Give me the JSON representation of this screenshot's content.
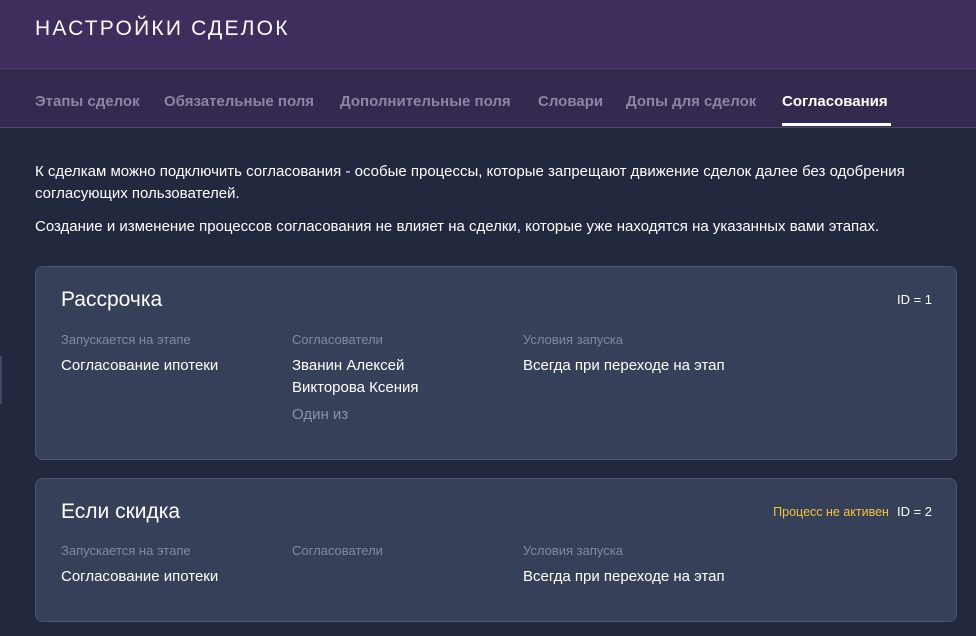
{
  "header": {
    "title": "НАСТРОЙКИ СДЕЛОК"
  },
  "tabs": [
    {
      "label": "Этапы сделок"
    },
    {
      "label": "Обязательные поля"
    },
    {
      "label": "Дополнительные поля"
    },
    {
      "label": "Словари"
    },
    {
      "label": "Допы для сделок"
    },
    {
      "label": "Согласования"
    }
  ],
  "active_tab": "Согласования",
  "intro": {
    "paragraph1": "К сделкам можно подключить согласования - особые процессы, которые запрещают движение сделок далее без одобрения согласующих пользователей.",
    "paragraph2": "Создание и изменение процессов согласования не влияет на сделки, которые уже находятся на указанных вами этапах."
  },
  "columns": {
    "stage_label": "Запускается на этапе",
    "approvers_label": "Согласователи",
    "conditions_label": "Условия запуска"
  },
  "processes": [
    {
      "title": "Рассрочка",
      "id_text": "ID = 1",
      "status": "",
      "stage": "Согласование ипотеки",
      "approvers": [
        "Званин Алексей",
        "Викторова Ксения"
      ],
      "approver_mode": "Один из",
      "condition": "Всегда при переходе на этап"
    },
    {
      "title": "Если скидка",
      "id_text": "ID = 2",
      "status": "Процесс не активен",
      "stage": "Согласование ипотеки",
      "approvers": [],
      "approver_mode": "",
      "condition": "Всегда при переходе на этап"
    }
  ],
  "colors": {
    "header_bg": "#3f2d5e",
    "tabs_bg": "#342a4f",
    "page_bg": "#22293f",
    "card_bg": "#364059",
    "status_inactive": "#f5c23b"
  }
}
